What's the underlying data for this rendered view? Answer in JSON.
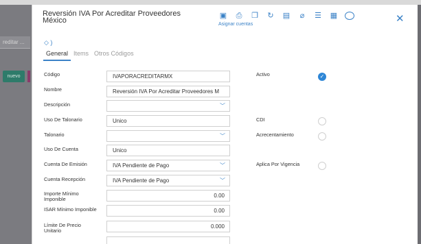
{
  "background": {
    "search_value": "reditar ...",
    "new_button": "nuevo"
  },
  "modal": {
    "title": "Reversión IVA Por Acreditar Proveedores México",
    "assign_link": "Asignar cuentas",
    "tabs": [
      {
        "label": "General",
        "active": true
      },
      {
        "label": "Items",
        "active": false
      },
      {
        "label": "Otros Códigos",
        "active": false
      }
    ]
  },
  "form": {
    "codigo": {
      "label": "Código",
      "value": "IVAPORACREDITARMX"
    },
    "nombre": {
      "label": "Nombre",
      "value": "Reversión IVA Por Acreditar Proveedores M"
    },
    "descripcion": {
      "label": "Descripción",
      "value": ""
    },
    "uso_talonario": {
      "label": "Uso De Talonario",
      "value": "Unico"
    },
    "talonario": {
      "label": "Talonario",
      "value": ""
    },
    "uso_cuenta": {
      "label": "Uso De Cuenta",
      "value": "Unico"
    },
    "cuenta_emision": {
      "label": "Cuenta De Emisión",
      "value": "IVA Pendiente de Pago"
    },
    "cuenta_recepcion": {
      "label": "Cuenta Recepción",
      "value": "IVA Pendiente de Pago"
    },
    "importe_minimo": {
      "label": "Importe Mínimo Imponible",
      "value": "0.00"
    },
    "isar_minimo": {
      "label": "ISAR Mínimo Imponible",
      "value": "0.00"
    },
    "limite_precio": {
      "label": "Límite De Precio Unitario",
      "value": "0.000"
    }
  },
  "toggles": {
    "activo": {
      "label": "Activo",
      "checked": true
    },
    "cdi": {
      "label": "CDI",
      "checked": false
    },
    "acrecentamiento": {
      "label": "Acrecentamiento",
      "checked": false
    },
    "aplica_vigencia": {
      "label": "Aplica Por Vigencia",
      "checked": false
    }
  },
  "colors": {
    "accent": "#3b82c7",
    "check": "#2e86d6"
  }
}
